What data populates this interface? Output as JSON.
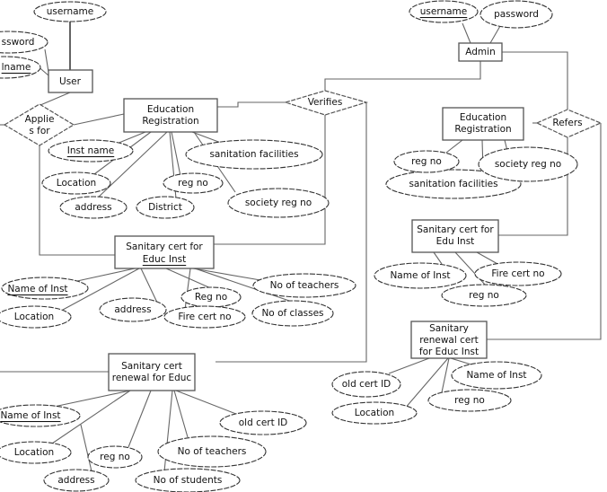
{
  "diagram": {
    "type": "ER diagram",
    "entities": [
      {
        "id": "user",
        "label": [
          "User"
        ]
      },
      {
        "id": "edu-reg-left",
        "label": [
          "Education",
          "Registration"
        ]
      },
      {
        "id": "sanitary-cert-left",
        "label": [
          "Sanitary cert for",
          "Educ Inst"
        ]
      },
      {
        "id": "sanitary-renewal-left",
        "label": [
          "Sanitary cert",
          "renewal for Educ"
        ]
      },
      {
        "id": "admin",
        "label": [
          "Admin"
        ]
      },
      {
        "id": "edu-reg-right",
        "label": [
          "Education",
          "Registration"
        ]
      },
      {
        "id": "sanitary-cert-right",
        "label": [
          "Sanitary cert for",
          "Edu Inst"
        ]
      },
      {
        "id": "sanitary-renewal-right",
        "label": [
          "Sanitary",
          "renewal cert",
          "for Educ Inst"
        ]
      }
    ],
    "relationships": [
      {
        "id": "applies-for",
        "label": [
          "Applie",
          "s for"
        ]
      },
      {
        "id": "verifies",
        "label": [
          "Verifies"
        ]
      },
      {
        "id": "refers",
        "label": [
          "Refers"
        ]
      }
    ],
    "attributes": {
      "user": [
        {
          "label": "username",
          "key": false
        },
        {
          "label": "ssword",
          "key": false
        },
        {
          "label": "lname",
          "key": true
        }
      ],
      "edu_reg_left": [
        {
          "label": "Inst name",
          "key": true
        },
        {
          "label": "Location",
          "key": false
        },
        {
          "label": "address",
          "key": false
        },
        {
          "label": "District",
          "key": false
        },
        {
          "label": "reg no",
          "key": false
        },
        {
          "label": "sanitation facilities",
          "key": false
        },
        {
          "label": "society reg no",
          "key": false
        }
      ],
      "sanitary_cert_left": [
        {
          "label": "Name of Inst",
          "key": true
        },
        {
          "label": "Location",
          "key": false
        },
        {
          "label": "address",
          "key": false
        },
        {
          "label": "Reg no",
          "key": false
        },
        {
          "label": "Fire cert no",
          "key": false
        },
        {
          "label": "No of teachers",
          "key": false
        },
        {
          "label": "No of classes",
          "key": false
        }
      ],
      "sanitary_renewal_left": [
        {
          "label": "Name of Inst",
          "key": true
        },
        {
          "label": "Location",
          "key": false
        },
        {
          "label": "address",
          "key": false
        },
        {
          "label": "reg no",
          "key": false
        },
        {
          "label": "No of teachers",
          "key": false
        },
        {
          "label": "No of students",
          "key": false
        },
        {
          "label": "old cert ID",
          "key": false
        }
      ],
      "admin": [
        {
          "label": "username",
          "key": true
        },
        {
          "label": "password",
          "key": false
        }
      ],
      "edu_reg_right": [
        {
          "label": "reg no",
          "key": false
        },
        {
          "label": "society reg no",
          "key": false
        },
        {
          "label": "sanitation facilities",
          "key": false
        }
      ],
      "sanitary_cert_right": [
        {
          "label": "Name of Inst",
          "key": false
        },
        {
          "label": "Fire cert no",
          "key": false
        },
        {
          "label": "reg no",
          "key": false
        }
      ],
      "sanitary_renewal_right": [
        {
          "label": "old cert ID",
          "key": false
        },
        {
          "label": "Name of Inst",
          "key": false
        },
        {
          "label": "reg no",
          "key": false
        },
        {
          "label": "Location",
          "key": false
        }
      ]
    }
  }
}
